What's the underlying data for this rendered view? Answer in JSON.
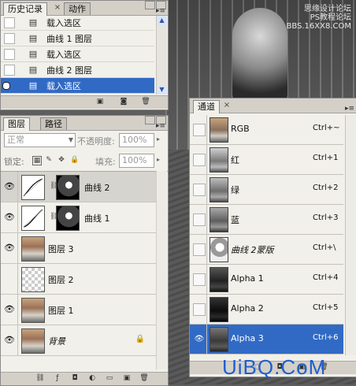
{
  "watermark": {
    "line1": "思缘设计论坛",
    "line2": "PS教程论坛",
    "line3": "BBS.16XX8.COM"
  },
  "history": {
    "tabs": [
      {
        "label": "历史记录",
        "close": "×"
      },
      {
        "label": "动作"
      }
    ],
    "items": [
      {
        "label": "载入选区",
        "selected": false
      },
      {
        "label": "曲线 1 图层",
        "selected": false
      },
      {
        "label": "载入选区",
        "selected": false
      },
      {
        "label": "曲线 2 图层",
        "selected": false
      },
      {
        "label": "载入选区",
        "selected": true
      }
    ]
  },
  "layers": {
    "tabs": [
      {
        "label": "图层"
      },
      {
        "label": "路径"
      }
    ],
    "blend_mode": "正常",
    "opacity_label": "不透明度:",
    "opacity_value": "100%",
    "lock_label": "锁定:",
    "fill_label": "填充:",
    "fill_value": "100%",
    "items": [
      {
        "name": "曲线 2",
        "kind": "adjustment",
        "visible": true,
        "selected": true
      },
      {
        "name": "曲线 1",
        "kind": "adjustment",
        "visible": true,
        "selected": false
      },
      {
        "name": "图层 3",
        "kind": "photo",
        "visible": true,
        "selected": false
      },
      {
        "name": "图层 2",
        "kind": "transparent",
        "visible": false,
        "selected": false
      },
      {
        "name": "图层 1",
        "kind": "photo",
        "visible": true,
        "selected": false
      },
      {
        "name": "背景",
        "kind": "photo",
        "visible": true,
        "selected": false,
        "locked": true
      }
    ]
  },
  "channels": {
    "tabs": [
      {
        "label": "通道",
        "close": "×"
      }
    ],
    "items": [
      {
        "name": "RGB",
        "shortcut": "Ctrl+~",
        "visible": false,
        "thumb": "#b89a80"
      },
      {
        "name": "红",
        "shortcut": "Ctrl+1",
        "visible": false,
        "thumb": "#9a9a9a"
      },
      {
        "name": "绿",
        "shortcut": "Ctrl+2",
        "visible": false,
        "thumb": "#8c8c8c"
      },
      {
        "name": "蓝",
        "shortcut": "Ctrl+3",
        "visible": false,
        "thumb": "#7a7a7a"
      },
      {
        "name": "曲线 2蒙版",
        "shortcut": "Ctrl+\\",
        "visible": false,
        "thumb": "#e0e0e0"
      },
      {
        "name": "Alpha 1",
        "shortcut": "Ctrl+4",
        "visible": false,
        "thumb": "#3a3a3a"
      },
      {
        "name": "Alpha 2",
        "shortcut": "Ctrl+5",
        "visible": false,
        "thumb": "#1e1e1e"
      },
      {
        "name": "Alpha 3",
        "shortcut": "Ctrl+6",
        "visible": true,
        "selected": true,
        "thumb": "#5a5a5a"
      }
    ]
  },
  "logo": {
    "text": "UiBQ.CoM",
    "color": "#1f5fcf"
  },
  "colors": {
    "selection": "#316ac5",
    "panel_bg": "#f1f0ea",
    "tab_bg": "#d4d0c8"
  }
}
